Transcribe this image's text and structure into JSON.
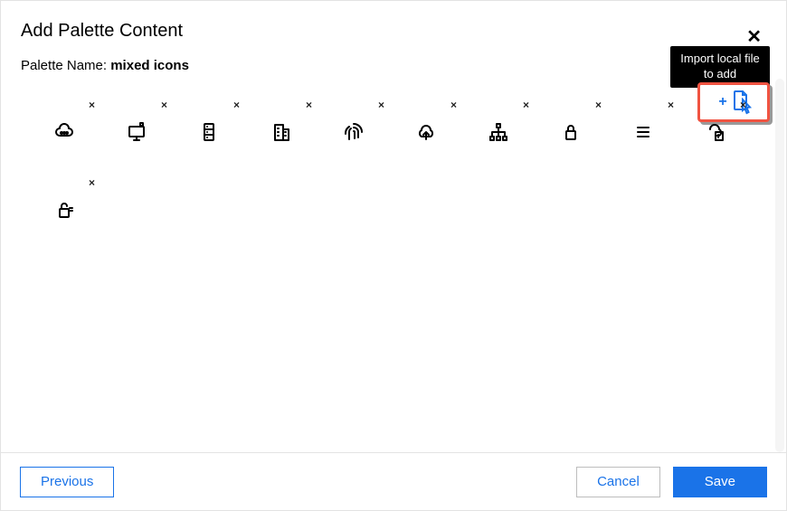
{
  "dialog": {
    "title": "Add Palette Content",
    "palette_name_label": "Palette Name:",
    "palette_name_value": "mixed icons",
    "close_symbol": "✕"
  },
  "tooltip": {
    "text": "Import local file to add"
  },
  "import": {
    "plus_symbol": "+"
  },
  "icons": [
    {
      "id": "cloud-nodes-icon",
      "remove": "×"
    },
    {
      "id": "monitor-icon",
      "remove": "×"
    },
    {
      "id": "server-rack-icon",
      "remove": "×"
    },
    {
      "id": "building-icon",
      "remove": "×"
    },
    {
      "id": "fingerprint-icon",
      "remove": "×"
    },
    {
      "id": "cloud-upload-icon",
      "remove": "×"
    },
    {
      "id": "hierarchy-icon",
      "remove": "×"
    },
    {
      "id": "lock-icon",
      "remove": "×"
    },
    {
      "id": "list-icon",
      "remove": "×"
    },
    {
      "id": "cloud-building-icon",
      "remove": "×"
    },
    {
      "id": "unlock-icon",
      "remove": "×"
    }
  ],
  "footer": {
    "previous": "Previous",
    "cancel": "Cancel",
    "save": "Save"
  }
}
